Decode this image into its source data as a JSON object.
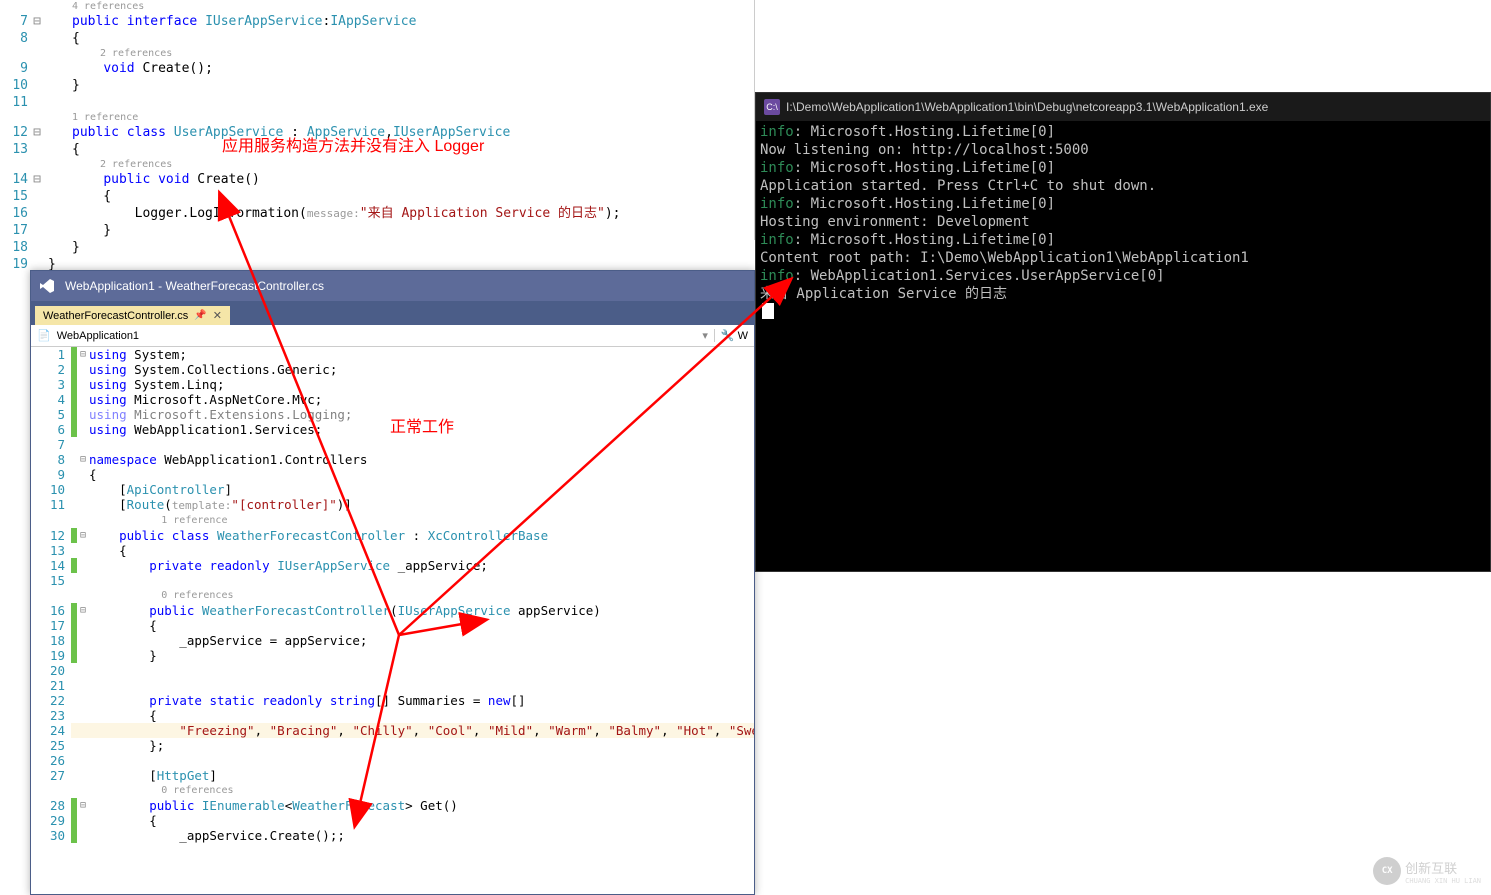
{
  "topEditor": {
    "refs": {
      "four": "4 references",
      "two": "2 references",
      "one": "1 reference"
    },
    "lines": {
      "7": {
        "ln": "7",
        "code_html": "<span class='k'>public</span> <span class='k'>interface</span> <span class='t'>IUserAppService</span>:<span class='t'>IAppService</span>"
      },
      "8": {
        "ln": "8",
        "code_html": "{"
      },
      "9": {
        "ln": "9",
        "code_html": "    <span class='k'>void</span> Create();"
      },
      "10": {
        "ln": "10",
        "code_html": "}"
      },
      "11": {
        "ln": "11",
        "code_html": ""
      },
      "12": {
        "ln": "12",
        "code_html": "<span class='k'>public</span> <span class='k'>class</span> <span class='t'>UserAppService</span> : <span class='t'>AppService</span>,<span class='t'>IUserAppService</span>"
      },
      "13": {
        "ln": "13",
        "code_html": "{"
      },
      "14": {
        "ln": "14",
        "code_html": "    <span class='k'>public</span> <span class='k'>void</span> Create()"
      },
      "15": {
        "ln": "15",
        "code_html": "    {"
      },
      "16": {
        "ln": "16",
        "code_html": "        Logger.LogInformation(<span class='param-hint'>message:</span><span class='s'>\"来自 Application Service 的日志\"</span>);"
      },
      "17": {
        "ln": "17",
        "code_html": "    }"
      },
      "18": {
        "ln": "18",
        "code_html": "}"
      },
      "19": {
        "ln": "19",
        "code_html": "}"
      }
    }
  },
  "vsWindow": {
    "title": "WebApplication1 - WeatherForecastController.cs",
    "tab": {
      "label": "WeatherForecastController.cs",
      "pin": "📌",
      "close": "✕"
    },
    "crumb_left": "WebApplication1",
    "crumb_right": "W",
    "refs": {
      "one": "1 reference",
      "zero": "0 references"
    },
    "lines": {
      "1": "<span class='k'>using</span> System;",
      "2": "<span class='k'>using</span> System.Collections.Generic;",
      "3": "<span class='k'>using</span> System.Linq;",
      "4": "<span class='k'>using</span> Microsoft.AspNetCore.Mvc;",
      "5": "<span class='k' style='opacity:.5'>using</span><span style='opacity:.5'> Microsoft.Extensions.Logging;</span>",
      "6": "<span class='k'>using</span> WebApplication1.Services;",
      "7": "",
      "8": "<span class='k'>namespace</span> WebApplication1.Controllers",
      "9": "{",
      "10": "    [<span class='t'>ApiController</span>]",
      "11": "    [<span class='t'>Route</span>(<span class='param-hint'>template:</span><span class='s'>\"[controller]\"</span>)]",
      "12": "    <span class='k'>public</span> <span class='k'>class</span> <span class='t'>WeatherForecastController</span> : <span class='t'>XcControllerBase</span>",
      "13": "    {",
      "14": "        <span class='k'>private</span> <span class='k'>readonly</span> <span class='t'>IUserAppService</span> _appService;",
      "15": "",
      "16": "        <span class='k'>public</span> <span class='t'>WeatherForecastController</span>(<span class='t'>IUserAppService</span> appService)",
      "17": "        {",
      "18": "            _appService = appService;",
      "19": "        }",
      "20": "",
      "21": "",
      "22": "        <span class='k'>private</span> <span class='k'>static</span> <span class='k'>readonly</span> <span class='k'>string</span>[] Summaries = <span class='k'>new</span>[]",
      "23": "        {",
      "24": "            <span class='s'>\"Freezing\"</span>, <span class='s'>\"Bracing\"</span>, <span class='s'>\"Chilly\"</span>, <span class='s'>\"Cool\"</span>, <span class='s'>\"Mild\"</span>, <span class='s'>\"Warm\"</span>, <span class='s'>\"Balmy\"</span>, <span class='s'>\"Hot\"</span>, <span class='s'>\"Sweltering\"</span>, <span class='s'>\"Scorching\"</span>",
      "25": "        };",
      "26": "",
      "27": "        [<span class='t'>HttpGet</span>]",
      "28": "        <span class='k'>public</span> <span class='t'>IEnumerable</span>&lt;<span class='t'>WeatherForecast</span>&gt; Get()",
      "29": "        {",
      "30": "            _appService.Create();;"
    }
  },
  "console": {
    "title": "I:\\Demo\\WebApplication1\\WebApplication1\\bin\\Debug\\netcoreapp3.1\\WebApplication1.exe",
    "lines": [
      {
        "lvl": "info",
        "txt": ": Microsoft.Hosting.Lifetime[0]"
      },
      {
        "lvl": "",
        "txt": "      Now listening on: http://localhost:5000"
      },
      {
        "lvl": "info",
        "txt": ": Microsoft.Hosting.Lifetime[0]"
      },
      {
        "lvl": "",
        "txt": "      Application started. Press Ctrl+C to shut down."
      },
      {
        "lvl": "info",
        "txt": ": Microsoft.Hosting.Lifetime[0]"
      },
      {
        "lvl": "",
        "txt": "      Hosting environment: Development"
      },
      {
        "lvl": "info",
        "txt": ": Microsoft.Hosting.Lifetime[0]"
      },
      {
        "lvl": "",
        "txt": "      Content root path: I:\\Demo\\WebApplication1\\WebApplication1"
      },
      {
        "lvl": "info",
        "txt": ": WebApplication1.Services.UserAppService[0]"
      },
      {
        "lvl": "",
        "txt": "      来自 Application Service 的日志"
      }
    ]
  },
  "annotations": {
    "a1": "应用服务构造方法并没有注入 Logger",
    "a2": "正常工作"
  },
  "watermark": {
    "text": "创新互联",
    "sub": "CHUANG XIN HU LIAN"
  }
}
